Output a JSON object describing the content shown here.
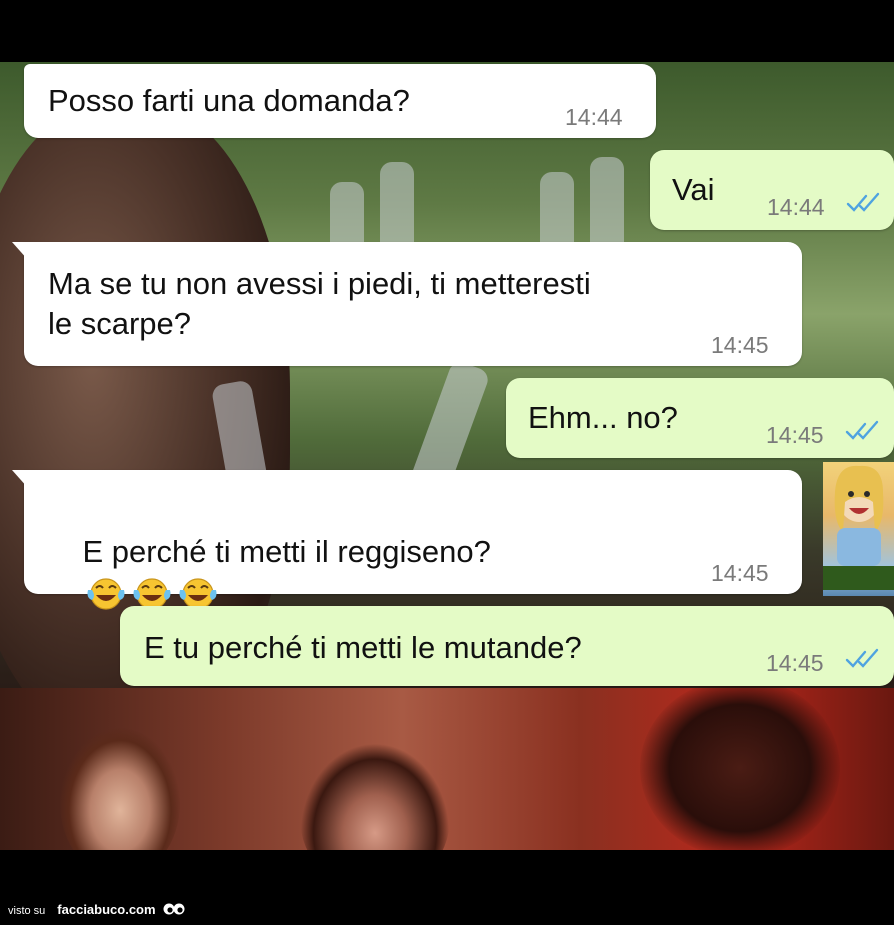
{
  "messages": [
    {
      "direction": "in",
      "text": "Posso farti una domanda?",
      "time": "14:44"
    },
    {
      "direction": "out",
      "text": "Vai",
      "time": "14:44",
      "status": "read-ticks-icon"
    },
    {
      "direction": "in",
      "text": "Ma se tu non avessi i piedi, ti metteresti\nle scarpe?",
      "time": "14:45"
    },
    {
      "direction": "out",
      "text": "Ehm... no?",
      "time": "14:45",
      "status": "read-ticks-icon"
    },
    {
      "direction": "in",
      "text": "E perché ti metti il reggiseno?",
      "time": "14:45",
      "emojis": [
        "tears-of-joy-icon",
        "tears-of-joy-icon",
        "tears-of-joy-icon"
      ]
    },
    {
      "direction": "out",
      "text": "E tu perché ti metti le mutande?",
      "time": "14:45",
      "status": "read-ticks-icon"
    }
  ],
  "colors": {
    "incoming_bubble": "#ffffff",
    "outgoing_bubble": "#e4fbc6",
    "read_ticks": "#4fa3e0",
    "timestamp": "#7a7a7a"
  },
  "watermark": {
    "prefix": "visto su",
    "site": "facciabuco.com"
  }
}
